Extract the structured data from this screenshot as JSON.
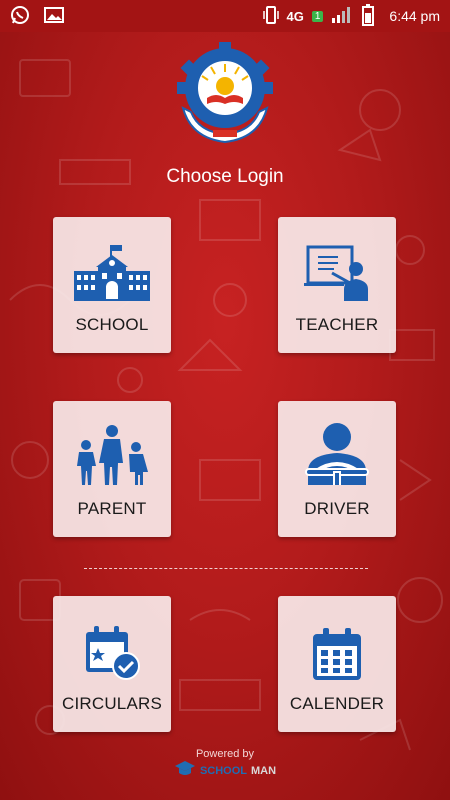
{
  "status_bar": {
    "time": "6:44 pm",
    "network": "4G",
    "sim_badge": "1",
    "left_icons": [
      "whatsapp-icon",
      "gallery-icon"
    ],
    "right_icons": [
      "vibrate-icon",
      "signal-icon",
      "battery-icon"
    ]
  },
  "header": {
    "title": "Choose Login"
  },
  "tiles": [
    {
      "label": "SCHOOL",
      "icon": "school-building-icon"
    },
    {
      "label": "TEACHER",
      "icon": "teacher-board-icon"
    },
    {
      "label": "PARENT",
      "icon": "family-icon"
    },
    {
      "label": "DRIVER",
      "icon": "driver-wheel-icon"
    },
    {
      "label": "CIRCULARS",
      "icon": "calendar-check-icon"
    },
    {
      "label": "CALENDER",
      "icon": "calendar-grid-icon"
    }
  ],
  "footer": {
    "powered_by": "Powered by",
    "brand_part1": "SCHOOL",
    "brand_part2": "MAN"
  },
  "colors": {
    "background": "#b21b1b",
    "icon_blue": "#1e5fb0",
    "tile_bg": "#f8e8e8"
  }
}
